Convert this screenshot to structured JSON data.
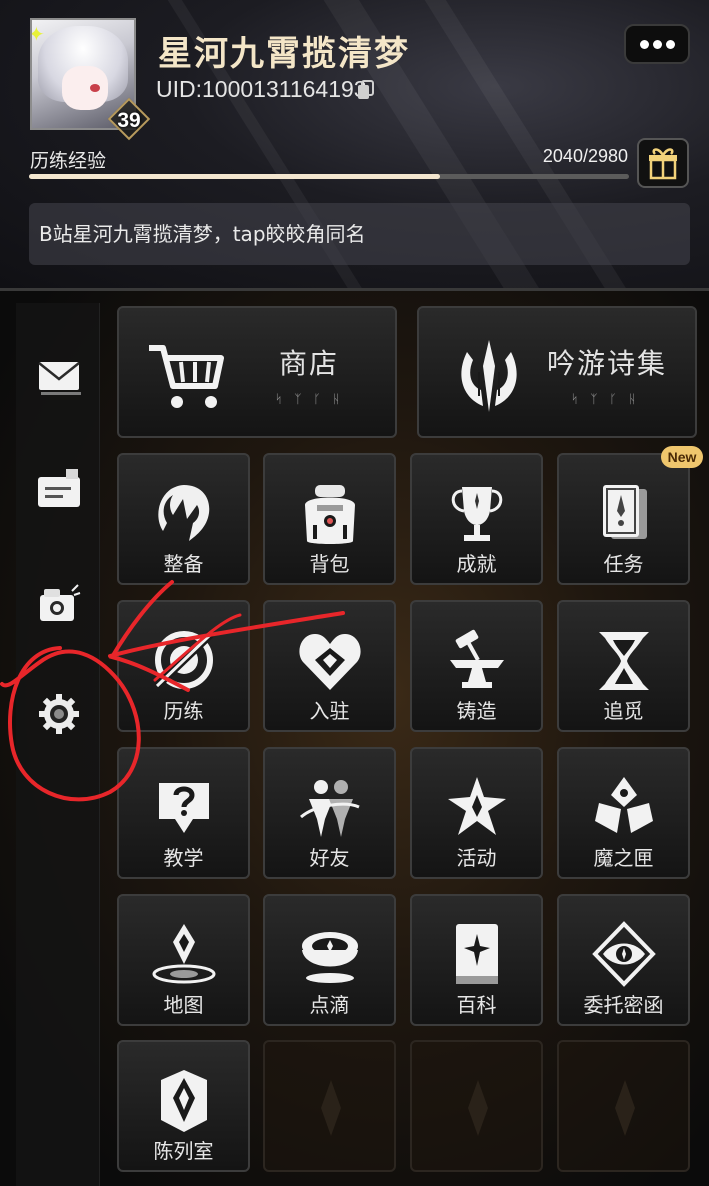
{
  "profile": {
    "name": "星河九霄揽清梦",
    "uid": "UID:1000131164193",
    "level": "39",
    "exp_label": "历练经验",
    "exp_value": "2040/2980",
    "exp_progress": 0.6846,
    "motto": "B站星河九霄揽清梦，tap皎皎角同名"
  },
  "header_buttons": {
    "more": "more-options",
    "gift": "gift-icon"
  },
  "sidebar": {
    "items": [
      {
        "name": "mail",
        "icon": "envelope-icon"
      },
      {
        "name": "announcement",
        "icon": "notice-icon"
      },
      {
        "name": "camera",
        "icon": "camera-icon"
      },
      {
        "name": "settings",
        "icon": "gear-icon"
      }
    ]
  },
  "feature_banners": [
    {
      "title": "商店",
      "sub": "ᛋᛉᚴᚺ",
      "icon": "cart-icon"
    },
    {
      "title": "吟游诗集",
      "sub": "ᛋᛉᚴᚺ",
      "icon": "lyre-icon"
    }
  ],
  "grid": [
    {
      "label": "整备",
      "icon": "character-icon"
    },
    {
      "label": "背包",
      "icon": "backpack-icon"
    },
    {
      "label": "成就",
      "icon": "trophy-icon"
    },
    {
      "label": "任务",
      "icon": "quest-icon",
      "badge": "New"
    },
    {
      "label": "历练",
      "icon": "training-icon"
    },
    {
      "label": "入驻",
      "icon": "settle-icon"
    },
    {
      "label": "铸造",
      "icon": "anvil-icon"
    },
    {
      "label": "追觅",
      "icon": "hourglass-icon"
    },
    {
      "label": "教学",
      "icon": "tutorial-icon"
    },
    {
      "label": "好友",
      "icon": "friends-icon"
    },
    {
      "label": "活动",
      "icon": "event-icon"
    },
    {
      "label": "魔之匣",
      "icon": "magic-box-icon"
    },
    {
      "label": "地图",
      "icon": "map-icon"
    },
    {
      "label": "点滴",
      "icon": "tea-icon"
    },
    {
      "label": "百科",
      "icon": "book-icon"
    },
    {
      "label": "委托密函",
      "icon": "eye-letter-icon"
    },
    {
      "label": "陈列室",
      "icon": "gallery-icon"
    }
  ],
  "colors": {
    "accent_gold": "#efc66d",
    "annotation_red": "#e8262a",
    "name_color": "#f4e6c8"
  }
}
